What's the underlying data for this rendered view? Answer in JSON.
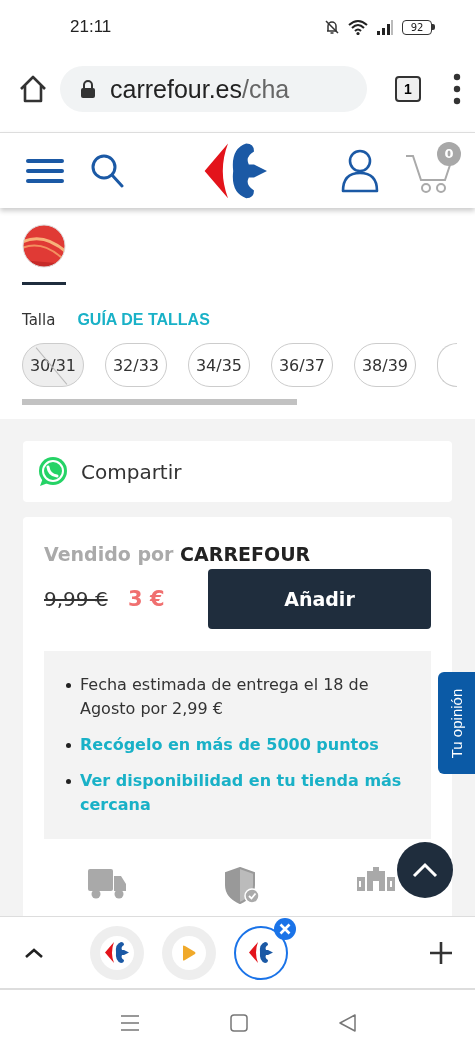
{
  "status_bar": {
    "time": "21:11",
    "battery": "92"
  },
  "browser": {
    "url_host": "carrefour.es",
    "url_path": "/cha",
    "tab_count": "1"
  },
  "site_header": {
    "cart_count": "0"
  },
  "product": {
    "swatches": [
      {
        "selected": true
      }
    ],
    "size_label": "Talla",
    "size_guide": "GUÍA DE TALLAS",
    "sizes": [
      {
        "label": "30/31",
        "disabled": true
      },
      {
        "label": "32/33",
        "disabled": false
      },
      {
        "label": "34/35",
        "disabled": false
      },
      {
        "label": "36/37",
        "disabled": false
      },
      {
        "label": "38/39",
        "disabled": false
      }
    ]
  },
  "share": {
    "label": "Compartir"
  },
  "offer": {
    "seller": "Vendido por **CARREFOUR**",
    "old_price": "9,99 €",
    "price": "3 €",
    "add_button": "Añadir",
    "info": [
      {
        "kind": "text",
        "text": "Fecha estimada de entrega el 18 de Agosto por 2,99 €"
      },
      {
        "kind": "link",
        "text": "Recógelo en más de 5000 puntos"
      },
      {
        "kind": "link",
        "text": "Ver disponibilidad en tu tienda más cercana"
      }
    ]
  },
  "feedback_tab": "Tu opinión",
  "tab_strip": {
    "tabs": [
      {
        "kind": "carrefour",
        "selected": false
      },
      {
        "kind": "play",
        "selected": false
      },
      {
        "kind": "carrefour",
        "selected": true
      }
    ]
  }
}
